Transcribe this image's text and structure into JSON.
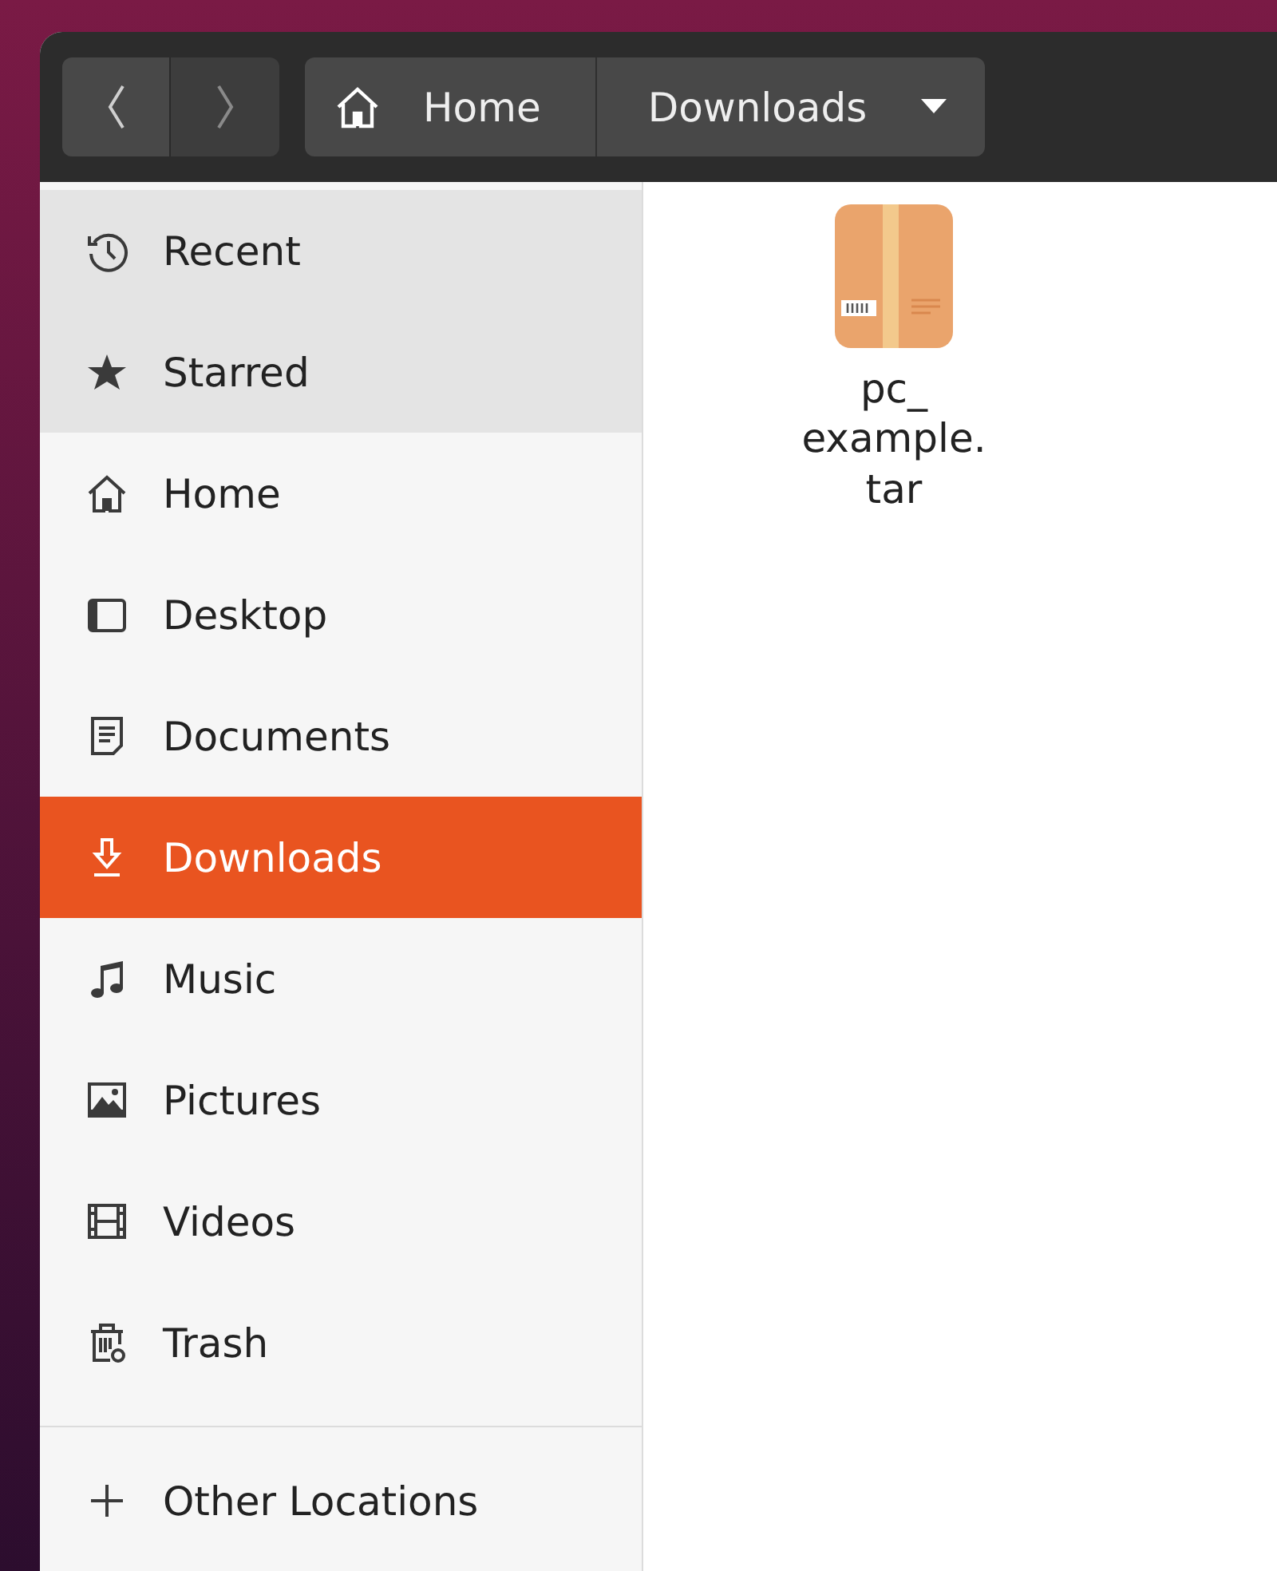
{
  "header": {
    "breadcrumbs": [
      {
        "label": "Home",
        "kind": "home"
      },
      {
        "label": "Downloads",
        "kind": "current"
      }
    ]
  },
  "sidebar": {
    "items": [
      {
        "label": "Recent",
        "kind": "recent",
        "selected": false,
        "hovered": true
      },
      {
        "label": "Starred",
        "kind": "starred",
        "selected": false,
        "hovered": true
      },
      {
        "label": "Home",
        "kind": "home",
        "selected": false,
        "hovered": false
      },
      {
        "label": "Desktop",
        "kind": "desktop",
        "selected": false,
        "hovered": false
      },
      {
        "label": "Documents",
        "kind": "documents",
        "selected": false,
        "hovered": false
      },
      {
        "label": "Downloads",
        "kind": "downloads",
        "selected": true,
        "hovered": false
      },
      {
        "label": "Music",
        "kind": "music",
        "selected": false,
        "hovered": false
      },
      {
        "label": "Pictures",
        "kind": "pictures",
        "selected": false,
        "hovered": false
      },
      {
        "label": "Videos",
        "kind": "videos",
        "selected": false,
        "hovered": false
      },
      {
        "label": "Trash",
        "kind": "trash",
        "selected": false,
        "hovered": false
      }
    ],
    "other": {
      "label": "Other Locations"
    }
  },
  "files": [
    {
      "name": "pc_example.tar",
      "kind": "archive"
    }
  ]
}
